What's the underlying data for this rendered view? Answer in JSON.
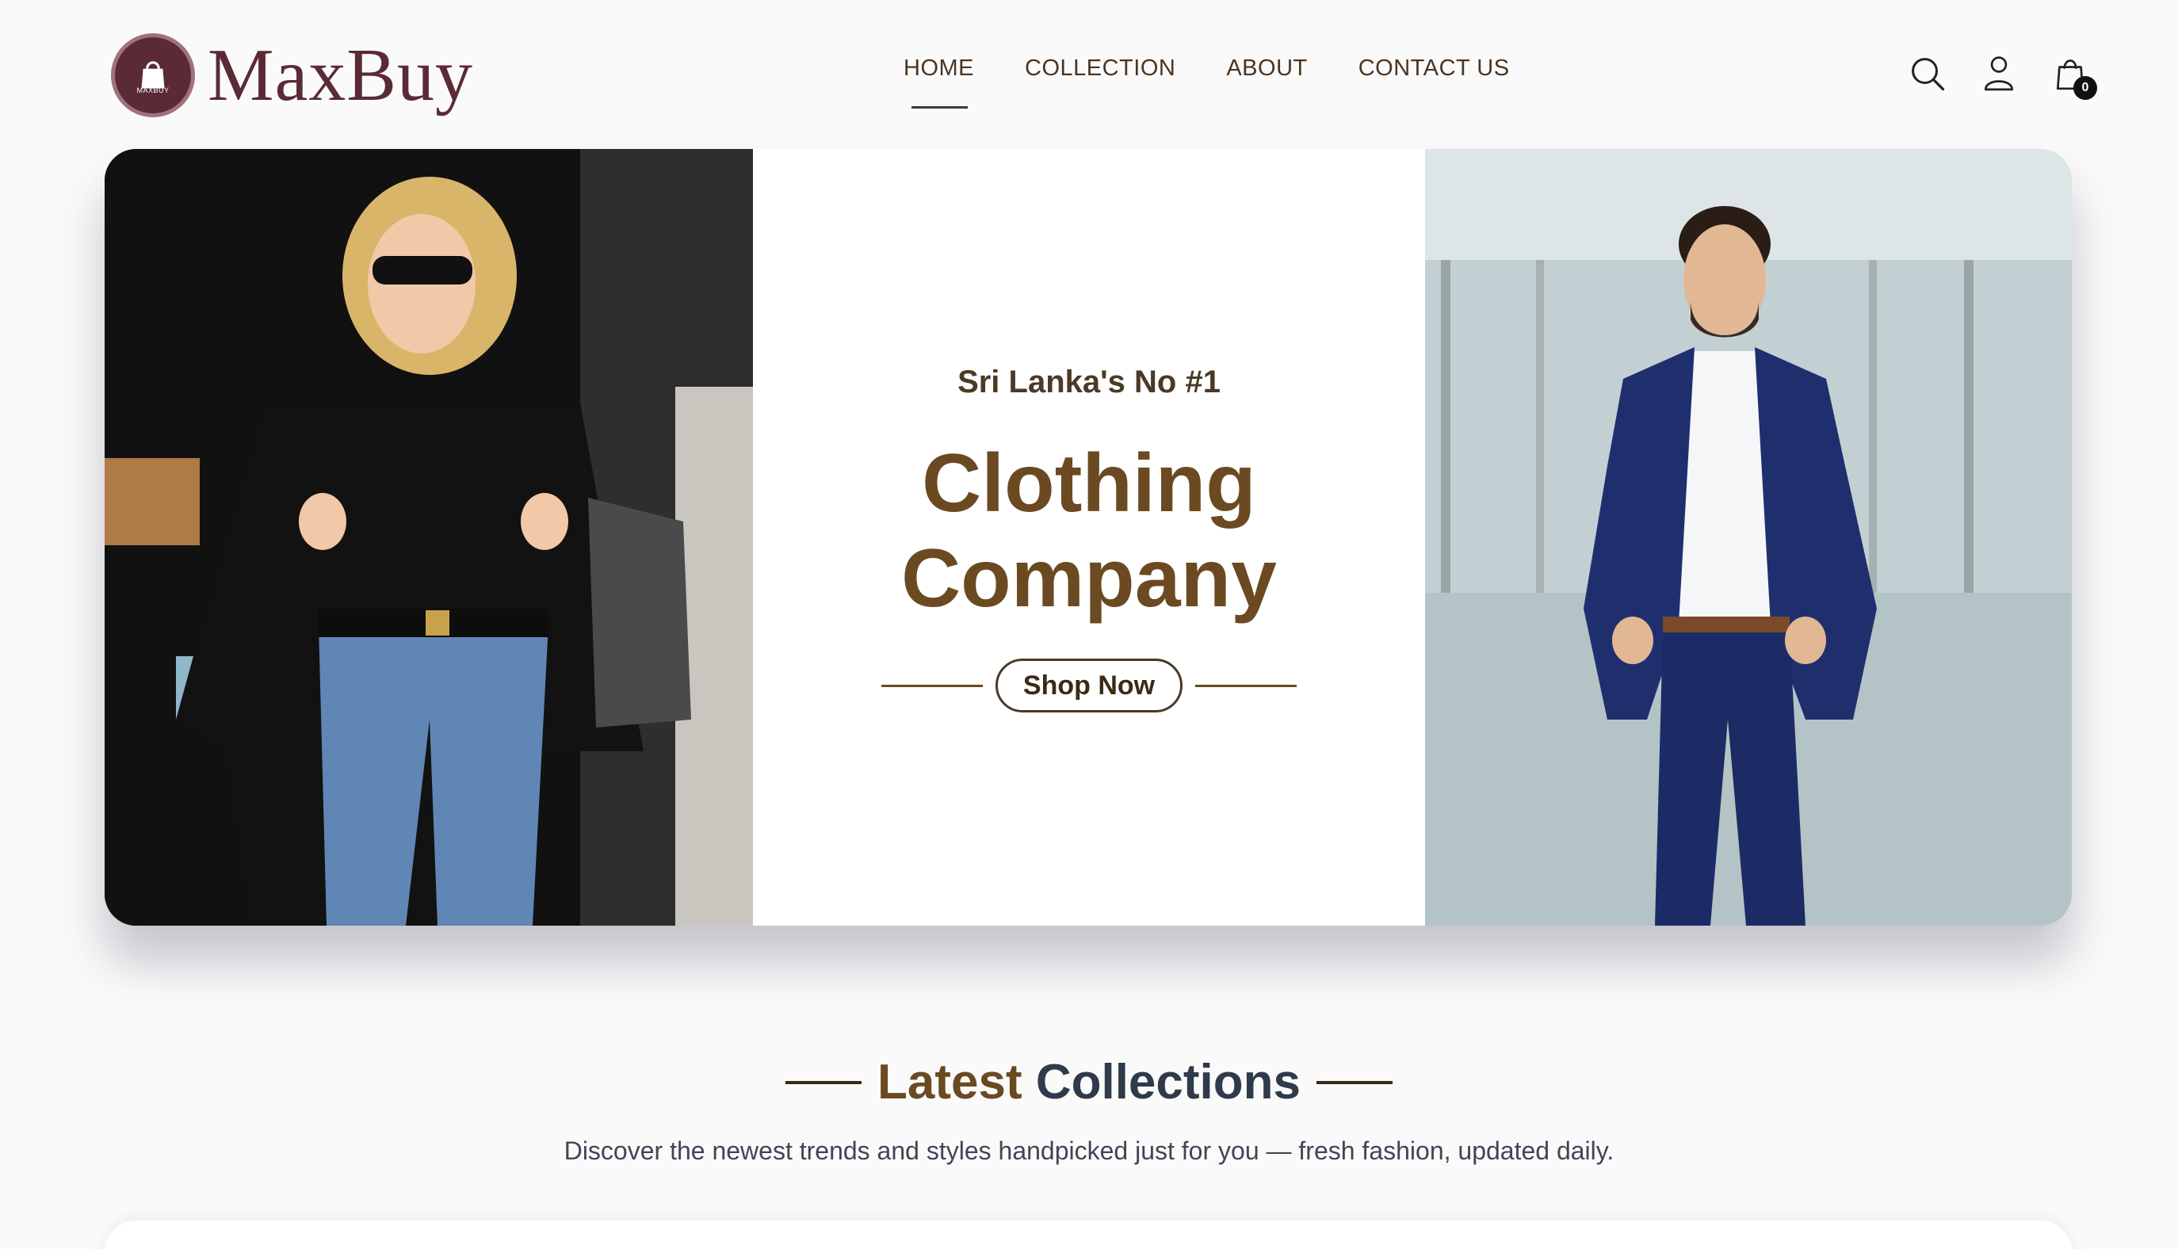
{
  "brand": {
    "name": "MaxBuy",
    "badge_text": "MAXBUY"
  },
  "nav": {
    "items": [
      {
        "label": "HOME",
        "active": true
      },
      {
        "label": "COLLECTION",
        "active": false
      },
      {
        "label": "ABOUT",
        "active": false
      },
      {
        "label": "CONTACT US",
        "active": false
      }
    ]
  },
  "header_icons": {
    "search": "search-icon",
    "profile": "user-icon",
    "cart": "shopping-bag-icon",
    "cart_count": "0"
  },
  "hero": {
    "tagline": "Sri Lanka's No #1",
    "title_line1": "Clothing",
    "title_line2": "Company",
    "cta_label": "Shop Now"
  },
  "latest": {
    "title_part1": "Latest",
    "title_part2": "Collections",
    "subtitle": "Discover the newest trends and styles handpicked just for you — fresh fashion, updated daily."
  },
  "colors": {
    "brand": "#5a2a35",
    "accent_brown": "#6b4a22",
    "text_dark": "#3b2a14",
    "navy": "#1f2f6e"
  }
}
